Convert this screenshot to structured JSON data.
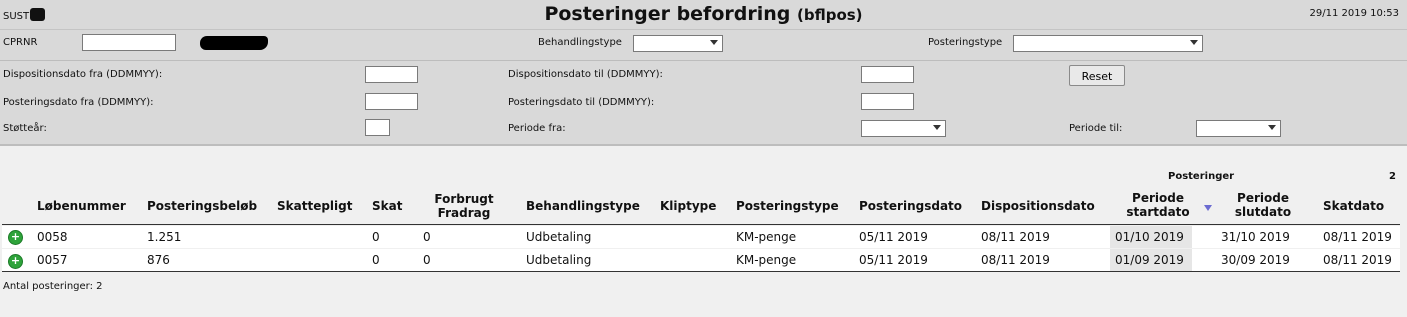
{
  "header": {
    "app_code": "SUST",
    "title": "Posteringer befordring",
    "title_code": "(bflpos)",
    "datetime": "29/11 2019 10:53"
  },
  "filters": {
    "cprnr_label": "CPRNR",
    "cprnr_value": "",
    "behandlingstype_label": "Behandlingstype",
    "behandlingstype_value": "",
    "posteringstype_label": "Posteringstype",
    "posteringstype_value": "",
    "disp_fra_label": "Dispositionsdato fra (DDMMYY):",
    "disp_til_label": "Dispositionsdato til (DDMMYY):",
    "post_fra_label": "Posteringsdato fra (DDMMYY):",
    "post_til_label": "Posteringsdato til (DDMMYY):",
    "stotteaar_label": "Støtteår:",
    "periode_fra_label": "Periode fra:",
    "periode_til_label": "Periode til:",
    "reset_label": "Reset"
  },
  "summary": {
    "label": "Posteringer",
    "count": "2"
  },
  "table": {
    "columns": {
      "lobenummer": "Løbenummer",
      "belob": "Posteringsbeløb",
      "skattepligt": "Skattepligt",
      "skat": "Skat",
      "forbrugt_1": "Forbrugt",
      "forbrugt_2": "Fradrag",
      "behandlingstype": "Behandlingstype",
      "kliptype": "Kliptype",
      "posteringstype": "Posteringstype",
      "posteringsdato": "Posteringsdato",
      "dispositionsdato": "Dispositionsdato",
      "periode_start_1": "Periode",
      "periode_start_2": "startdato",
      "periode_slut_1": "Periode",
      "periode_slut_2": "slutdato",
      "skatdato": "Skatdato"
    },
    "rows": [
      {
        "lobenummer": "0058",
        "belob": "1.251",
        "skattepligt": "",
        "skat": "0",
        "forbrugt": "0",
        "behandlingstype": "Udbetaling",
        "kliptype": "",
        "posteringstype": "KM-penge",
        "posteringsdato": "05/11 2019",
        "dispositionsdato": "08/11 2019",
        "periode_start": "01/10 2019",
        "periode_slut": "31/10 2019",
        "skatdato": "08/11 2019"
      },
      {
        "lobenummer": "0057",
        "belob": "876",
        "skattepligt": "",
        "skat": "0",
        "forbrugt": "0",
        "behandlingstype": "Udbetaling",
        "kliptype": "",
        "posteringstype": "KM-penge",
        "posteringsdato": "05/11 2019",
        "dispositionsdato": "08/11 2019",
        "periode_start": "01/09 2019",
        "periode_slut": "30/09 2019",
        "skatdato": "08/11 2019"
      }
    ]
  },
  "footer": {
    "count_text": "Antal posteringer: 2"
  },
  "icons": {
    "expand": "plus-circle-icon",
    "sort": "sort-descending-icon"
  },
  "colors": {
    "expand_green": "#2ea33a",
    "sort_blue": "#6b6bd1",
    "panel_gray": "#d9d9d9"
  }
}
